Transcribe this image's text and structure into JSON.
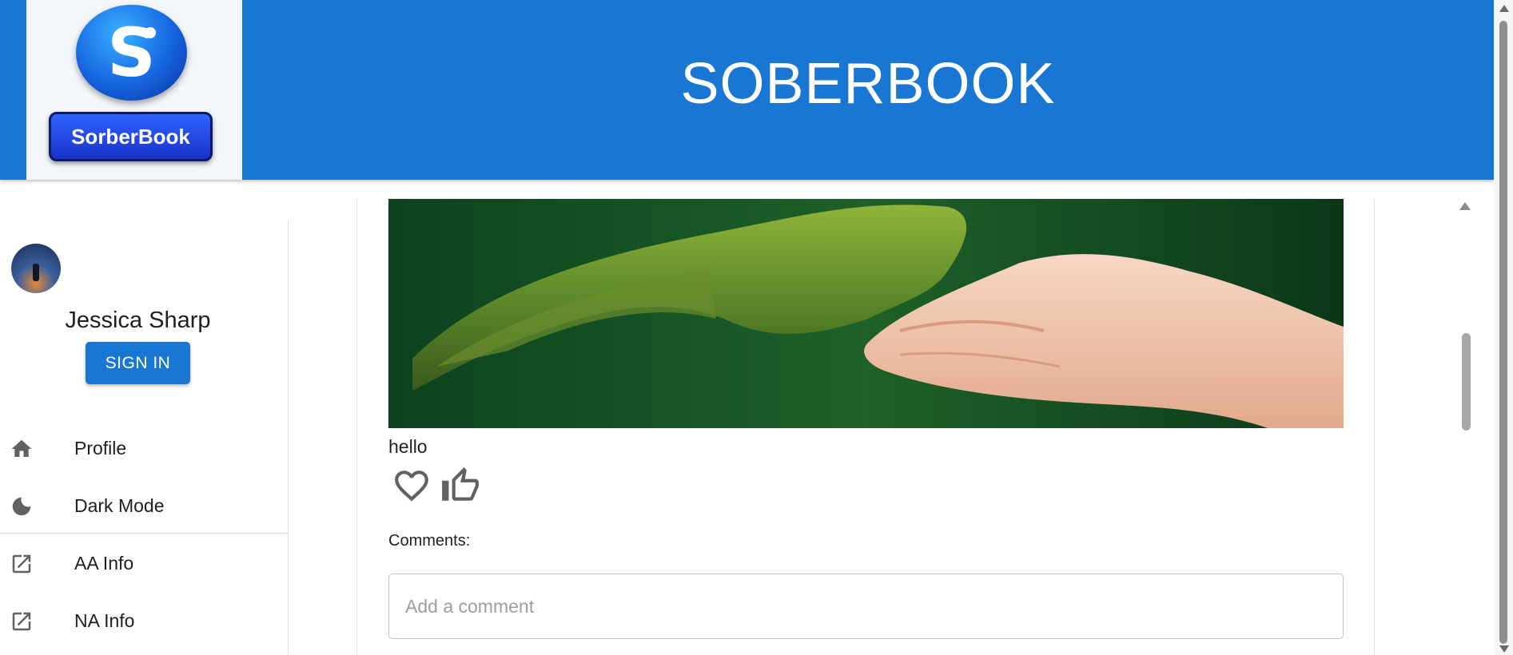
{
  "app": {
    "title": "SOBERBOOK",
    "logo_text": "SorberBook",
    "logo_letter": "S"
  },
  "colors": {
    "primary": "#1976d2",
    "text": "#1f1f1f",
    "icon": "#616161"
  },
  "sidebar": {
    "user_name": "Jessica Sharp",
    "signin_label": "SIGN IN",
    "items": [
      {
        "label": "Profile",
        "icon": "home-icon"
      },
      {
        "label": "Dark Mode",
        "icon": "moon-icon"
      },
      {
        "label": "AA Info",
        "icon": "external-link-icon"
      },
      {
        "label": "NA Info",
        "icon": "external-link-icon"
      }
    ]
  },
  "post": {
    "caption": "hello",
    "image_alt": "forest-shaped hand reaching a human hand",
    "actions": [
      {
        "icon": "heart-icon"
      },
      {
        "icon": "thumbs-up-icon"
      }
    ],
    "comments_label": "Comments:",
    "comment_placeholder": "Add a comment"
  }
}
